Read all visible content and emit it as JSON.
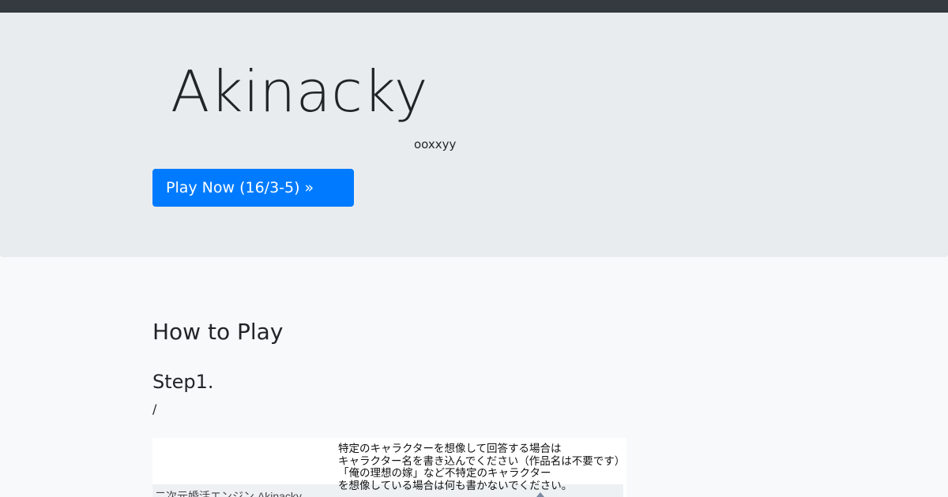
{
  "jumbotron": {
    "title": "Akinacky",
    "subtitle": "ooxxyy",
    "play_button_label": "Play Now (16/3-5) »"
  },
  "how_to_play": {
    "title": "How to Play",
    "steps": [
      {
        "title": "Step1.",
        "text": "/",
        "screenshot": {
          "app_title": "二次元婚活エンジン Akinacky",
          "instructions": [
            "特定のキャラクターを想像して回答する場合は",
            "キャラクター名を書き込んでください（作品名は不要です）",
            "「俺の理想の嫁」など不特定のキャラクター",
            "を想像している場合は何も書かないでください。"
          ]
        }
      }
    ]
  }
}
